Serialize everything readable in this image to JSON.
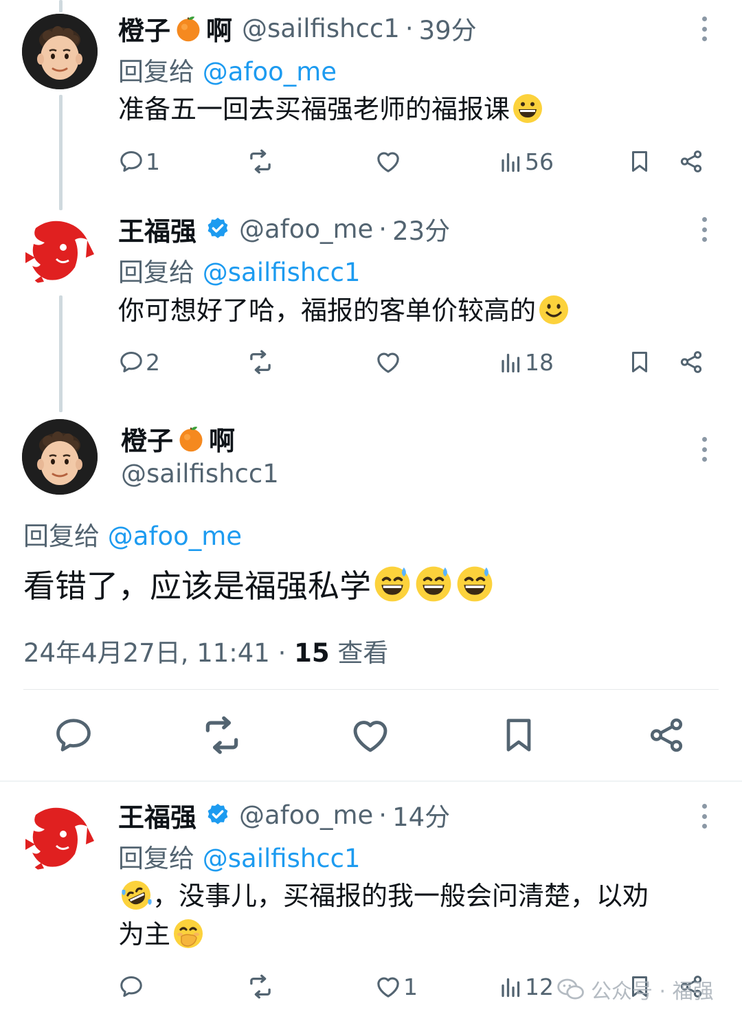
{
  "tweets": [
    {
      "name": "橙子",
      "name_suffix": "啊",
      "handle": "@sailfishcc1",
      "time": "39分",
      "reply_prefix": "回复给",
      "reply_to": "@afoo_me",
      "text": "准备五一回去买福强老师的福报课",
      "stats": {
        "replies": "1",
        "retweets": "",
        "likes": "",
        "views": "56"
      }
    },
    {
      "name": "王福强",
      "handle": "@afoo_me",
      "time": "23分",
      "reply_prefix": "回复给",
      "reply_to": "@sailfishcc1",
      "text": "你可想好了哈，福报的客单价较高的",
      "stats": {
        "replies": "2",
        "retweets": "",
        "likes": "",
        "views": "18"
      }
    },
    {
      "name": "橙子",
      "name_suffix": "啊",
      "handle": "@sailfishcc1",
      "reply_prefix": "回复给",
      "reply_to": "@afoo_me",
      "text": "看错了，应该是福强私学",
      "date": "24年4月27日, 11:41",
      "view_count": "15",
      "view_label": "查看"
    },
    {
      "name": "王福强",
      "handle": "@afoo_me",
      "time": "14分",
      "reply_prefix": "回复给",
      "reply_to": "@sailfishcc1",
      "text_line1": "，没事儿，买福报的我一般会问清楚，以劝",
      "text_line2": "为主",
      "stats": {
        "replies": "",
        "retweets": "",
        "likes": "1",
        "views": "12"
      }
    }
  ],
  "watermark": {
    "text": "公众号 · 福强"
  },
  "colors": {
    "accent": "#1d9bf0",
    "muted": "#536471",
    "verified": "#1d9bf0",
    "text": "#0f1419"
  },
  "icons": [
    "reply-icon",
    "retweet-icon",
    "like-icon",
    "views-icon",
    "bookmark-icon",
    "share-icon",
    "more-icon",
    "verified-icon",
    "orange-emoji",
    "grin-emoji",
    "smile-emoji",
    "sweat-smile-emoji",
    "rofl-emoji",
    "hand-over-mouth-emoji",
    "wechat-icon"
  ]
}
